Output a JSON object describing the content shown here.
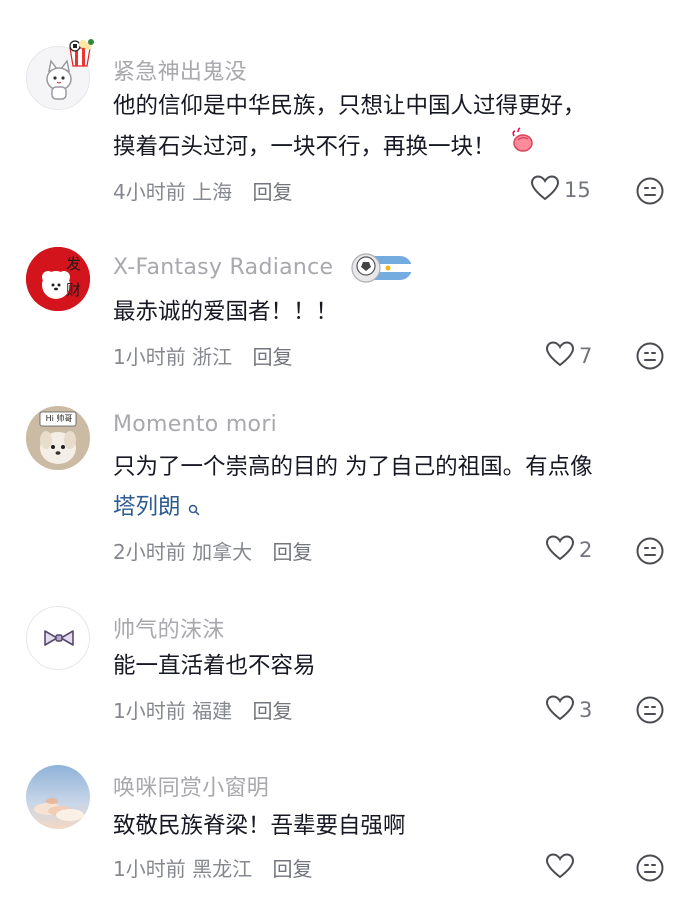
{
  "comments": [
    {
      "username": "紧急神出鬼没",
      "text_line1": "他的信仰是中华民族，只想让中国人过得更好，",
      "text_line2": "摸着石头过河，一块不行，再换一块！",
      "time": "4小时前",
      "location": "上海",
      "reply_label": "回复",
      "likes": "15",
      "avatar_icon": "white-cat-avatar",
      "badge_icon": "soccer-popcorn-badge-icon",
      "emoji_icon": "clapping-hands-emoji"
    },
    {
      "username": "X-Fantasy Radiance",
      "text_line1": "最赤诚的爱国者！！！",
      "time": "1小时前",
      "location": "浙江",
      "reply_label": "回复",
      "likes": "7",
      "avatar_icon": "fortune-dog-avatar",
      "avatar_text": "发 财",
      "badge_icon": "soccer-argentina-badge-icon"
    },
    {
      "username": "Momento mori",
      "text_line1": "只为了一个崇高的目的 为了自己的祖国。有点像",
      "link_text": "塔列朗",
      "time": "2小时前",
      "location": "加拿大",
      "reply_label": "回复",
      "likes": "2",
      "avatar_icon": "puppy-avatar",
      "avatar_text": "Hi 帅哥"
    },
    {
      "username": "帅气的沫沫",
      "text_line1": "能一直活着也不容易",
      "time": "1小时前",
      "location": "福建",
      "reply_label": "回复",
      "likes": "3",
      "avatar_icon": "bowtie-avatar"
    },
    {
      "username": "唤咪同赏小窗明",
      "text_line1": "致敬民族脊梁！吾辈要自强啊",
      "time": "1小时前",
      "location": "黑龙江",
      "reply_label": "回复",
      "likes": "",
      "avatar_icon": "sunset-sky-avatar"
    }
  ],
  "colors": {
    "username": "#a8a8ad",
    "text": "#161823",
    "meta": "#86888f",
    "link": "#2f5c8f"
  }
}
